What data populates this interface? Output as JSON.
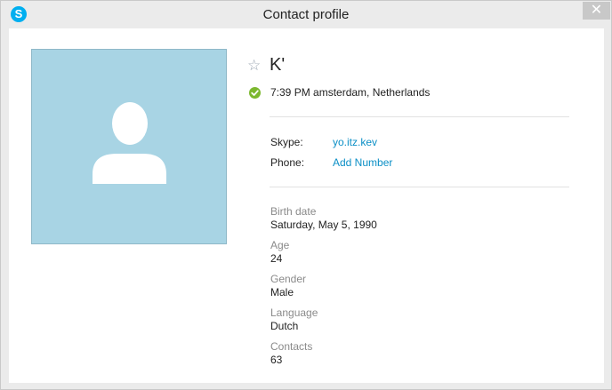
{
  "window": {
    "title": "Contact profile",
    "app_icon_letter": "S",
    "close_glyph": "✕"
  },
  "profile": {
    "name": "K'",
    "favorite_glyph": "☆",
    "status_color": "#7cb82f",
    "local_time_location": "7:39 PM amsterdam, Netherlands"
  },
  "contact": {
    "skype_label": "Skype:",
    "skype_value": "yo.itz.kev",
    "phone_label": "Phone:",
    "phone_value": "Add Number"
  },
  "details": [
    {
      "label": "Birth date",
      "value": "Saturday, May 5, 1990"
    },
    {
      "label": "Age",
      "value": "24"
    },
    {
      "label": "Gender",
      "value": "Male"
    },
    {
      "label": "Language",
      "value": "Dutch"
    },
    {
      "label": "Contacts",
      "value": "63"
    }
  ],
  "colors": {
    "link": "#0b8fc6",
    "avatar_bg": "#a8d4e4",
    "brand": "#00aff0"
  }
}
